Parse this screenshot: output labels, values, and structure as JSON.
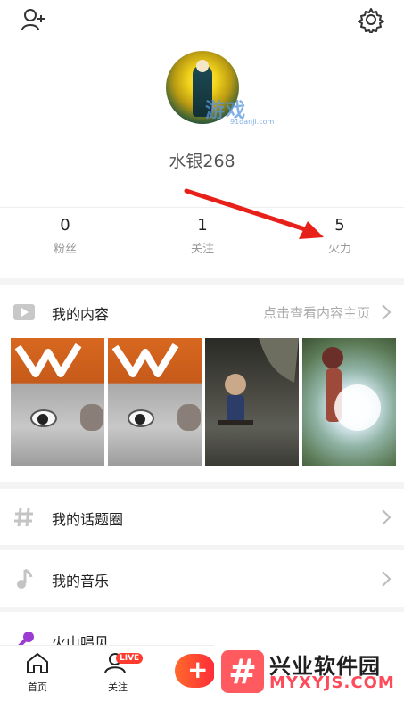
{
  "header": {
    "add_friend_icon": "add-user-icon",
    "settings_icon": "gear-icon"
  },
  "profile": {
    "username": "水银268",
    "avatar_watermark": "游戏",
    "avatar_watermark_sub": "91danji.com"
  },
  "stats": [
    {
      "value": "0",
      "label": "粉丝"
    },
    {
      "value": "1",
      "label": "关注"
    },
    {
      "value": "5",
      "label": "火力"
    }
  ],
  "content_section": {
    "title": "我的内容",
    "link": "点击查看内容主页",
    "icon": "video-icon"
  },
  "list": [
    {
      "label": "我的话题圈",
      "icon": "hashtag-icon"
    },
    {
      "label": "我的音乐",
      "icon": "music-note-icon"
    },
    {
      "label": "火山唱见",
      "icon": "microphone-icon"
    }
  ],
  "bottom_nav": {
    "home": "首页",
    "follow": "关注",
    "live_badge": "LIVE"
  },
  "watermark": {
    "name": "兴业软件园",
    "url": "MYXYJS.COM"
  },
  "colors": {
    "accent": "#ff3b2f",
    "arrow": "#e8201a",
    "muted_text": "#999999"
  }
}
